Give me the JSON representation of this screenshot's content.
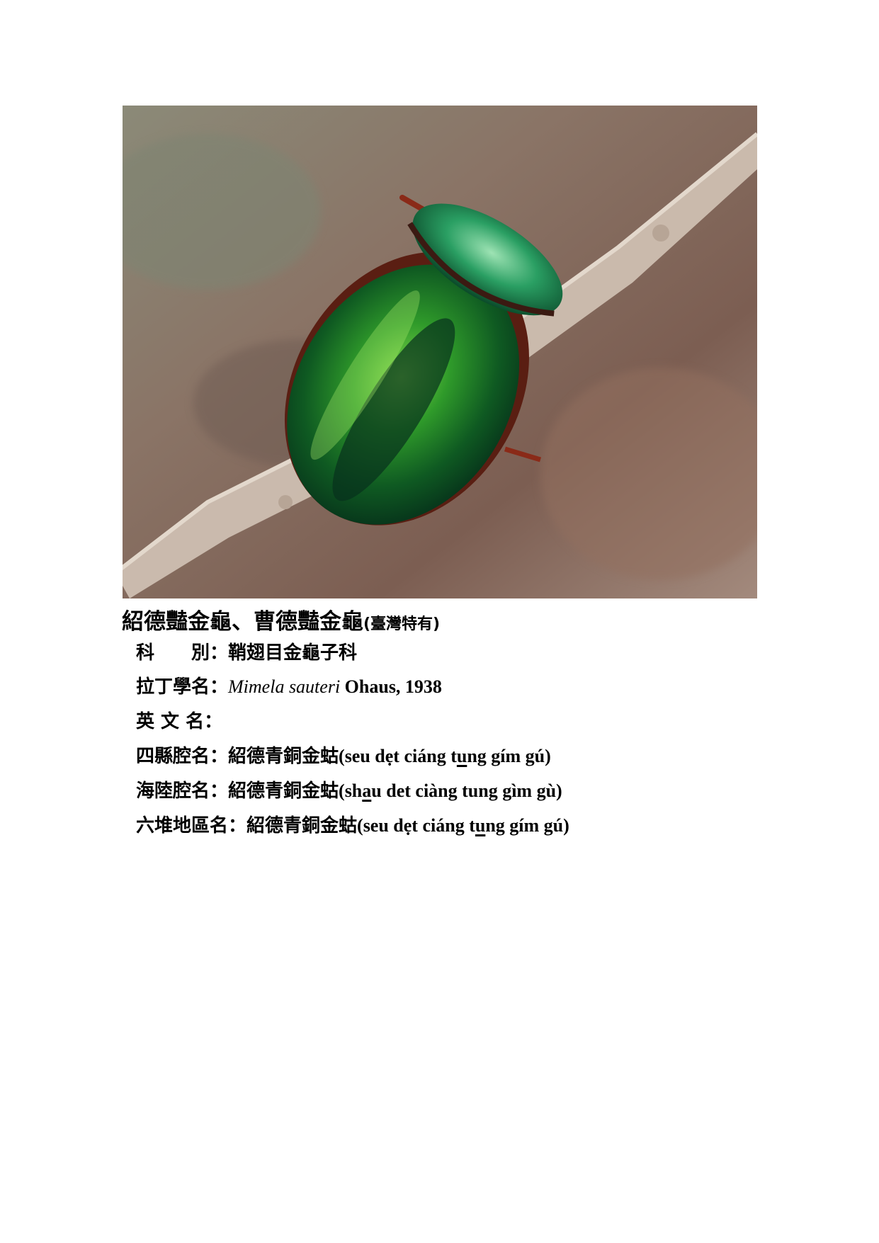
{
  "title": {
    "main": "紹德豔金龜、曹德豔金龜",
    "note": "(臺灣特有)"
  },
  "rows": {
    "family": {
      "label": "科　　別：",
      "value": "鞘翅目金龜子科"
    },
    "latin": {
      "label": "拉丁學名：",
      "genus_species": "Mimela sauteri",
      "author": " Ohaus, 1938"
    },
    "english": {
      "label": "英 文 名：",
      "value": ""
    },
    "sixian": {
      "label": "四縣腔名：",
      "han": "紹德青銅金蛄",
      "pre": "(seu dẹt ciáng t",
      "under": "u",
      "post": "ng gím gú)"
    },
    "hailu": {
      "label": "海陸腔名：",
      "han": "紹德青銅金蛄",
      "pre": "(sh",
      "under": "a",
      "post": "u det ciàng tung gìm gù)"
    },
    "liudui": {
      "label": "六堆地區名：",
      "han": "紹德青銅金蛄",
      "pre": "(seu dẹt ciáng t",
      "under": "u",
      "post": "ng gím gú)"
    }
  }
}
